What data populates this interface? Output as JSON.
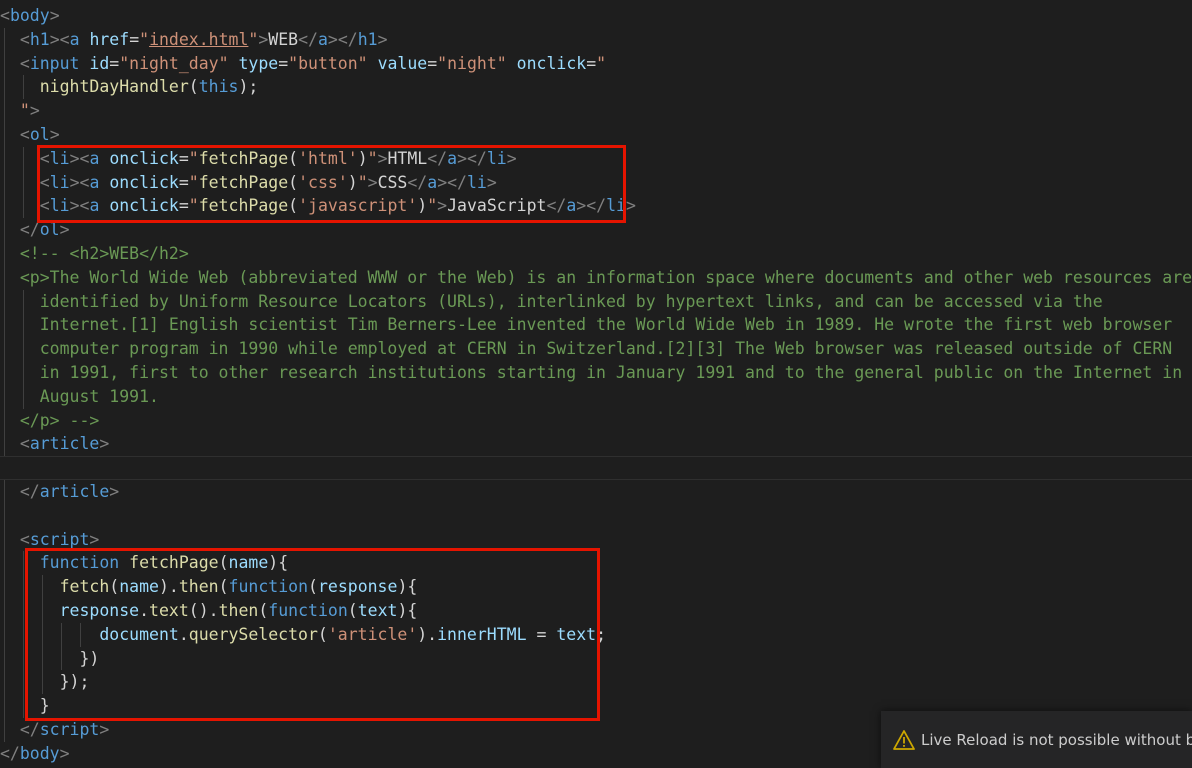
{
  "colors": {
    "background": "#1e1e1e",
    "punct": "#808080",
    "tag": "#569cd6",
    "attr": "#9cdcfe",
    "string": "#ce9178",
    "text": "#d4d4d4",
    "function": "#dcdcaa",
    "keyword": "#569cd6",
    "variable": "#9cdcfe",
    "comment": "#6a9955",
    "highlight_border": "#e51400",
    "warning_icon": "#cca700"
  },
  "editor": {
    "lines": [
      {
        "guides": [],
        "tokens": [
          {
            "t": "<",
            "c": "punct"
          },
          {
            "t": "body",
            "c": "tag"
          },
          {
            "t": ">",
            "c": "punct"
          }
        ]
      },
      {
        "guides": [
          0
        ],
        "tokens": [
          {
            "t": "  "
          },
          {
            "t": "<",
            "c": "punct"
          },
          {
            "t": "h1",
            "c": "tag"
          },
          {
            "t": ">",
            "c": "punct"
          },
          {
            "t": "<",
            "c": "punct"
          },
          {
            "t": "a",
            "c": "tag"
          },
          {
            "t": " "
          },
          {
            "t": "href",
            "c": "attr"
          },
          {
            "t": "=",
            "c": "txt"
          },
          {
            "t": "\"",
            "c": "str"
          },
          {
            "t": "index.html",
            "c": "str",
            "u": true
          },
          {
            "t": "\"",
            "c": "str"
          },
          {
            "t": ">",
            "c": "punct"
          },
          {
            "t": "WEB",
            "c": "txt"
          },
          {
            "t": "</",
            "c": "punct"
          },
          {
            "t": "a",
            "c": "tag"
          },
          {
            "t": ">",
            "c": "punct"
          },
          {
            "t": "</",
            "c": "punct"
          },
          {
            "t": "h1",
            "c": "tag"
          },
          {
            "t": ">",
            "c": "punct"
          }
        ]
      },
      {
        "guides": [
          0
        ],
        "tokens": [
          {
            "t": "  "
          },
          {
            "t": "<",
            "c": "punct"
          },
          {
            "t": "input",
            "c": "tag"
          },
          {
            "t": " "
          },
          {
            "t": "id",
            "c": "attr"
          },
          {
            "t": "=",
            "c": "txt"
          },
          {
            "t": "\"night_day\"",
            "c": "str"
          },
          {
            "t": " "
          },
          {
            "t": "type",
            "c": "attr"
          },
          {
            "t": "=",
            "c": "txt"
          },
          {
            "t": "\"button\"",
            "c": "str"
          },
          {
            "t": " "
          },
          {
            "t": "value",
            "c": "attr"
          },
          {
            "t": "=",
            "c": "txt"
          },
          {
            "t": "\"night\"",
            "c": "str"
          },
          {
            "t": " "
          },
          {
            "t": "onclick",
            "c": "attr"
          },
          {
            "t": "=",
            "c": "txt"
          },
          {
            "t": "\"",
            "c": "str"
          }
        ]
      },
      {
        "guides": [
          0,
          2
        ],
        "tokens": [
          {
            "t": "    "
          },
          {
            "t": "nightDayHandler",
            "c": "fn"
          },
          {
            "t": "(",
            "c": "txt"
          },
          {
            "t": "this",
            "c": "kw"
          },
          {
            "t": ");",
            "c": "txt"
          }
        ]
      },
      {
        "guides": [
          0
        ],
        "tokens": [
          {
            "t": "  "
          },
          {
            "t": "\"",
            "c": "str"
          },
          {
            "t": ">",
            "c": "punct"
          }
        ]
      },
      {
        "guides": [
          0
        ],
        "tokens": [
          {
            "t": "  "
          },
          {
            "t": "<",
            "c": "punct"
          },
          {
            "t": "ol",
            "c": "tag"
          },
          {
            "t": ">",
            "c": "punct"
          }
        ]
      },
      {
        "guides": [
          0,
          2
        ],
        "tokens": [
          {
            "t": "    "
          },
          {
            "t": "<",
            "c": "punct"
          },
          {
            "t": "li",
            "c": "tag"
          },
          {
            "t": ">",
            "c": "punct"
          },
          {
            "t": "<",
            "c": "punct"
          },
          {
            "t": "a",
            "c": "tag"
          },
          {
            "t": " "
          },
          {
            "t": "onclick",
            "c": "attr"
          },
          {
            "t": "=",
            "c": "txt"
          },
          {
            "t": "\"",
            "c": "str"
          },
          {
            "t": "fetchPage",
            "c": "fn"
          },
          {
            "t": "(",
            "c": "txt"
          },
          {
            "t": "'html'",
            "c": "str"
          },
          {
            "t": ")",
            "c": "txt"
          },
          {
            "t": "\"",
            "c": "str"
          },
          {
            "t": ">",
            "c": "punct"
          },
          {
            "t": "HTML",
            "c": "txt"
          },
          {
            "t": "</",
            "c": "punct"
          },
          {
            "t": "a",
            "c": "tag"
          },
          {
            "t": ">",
            "c": "punct"
          },
          {
            "t": "</",
            "c": "punct"
          },
          {
            "t": "li",
            "c": "tag"
          },
          {
            "t": ">",
            "c": "punct"
          }
        ]
      },
      {
        "guides": [
          0,
          2
        ],
        "tokens": [
          {
            "t": "    "
          },
          {
            "t": "<",
            "c": "punct"
          },
          {
            "t": "li",
            "c": "tag"
          },
          {
            "t": ">",
            "c": "punct"
          },
          {
            "t": "<",
            "c": "punct"
          },
          {
            "t": "a",
            "c": "tag"
          },
          {
            "t": " "
          },
          {
            "t": "onclick",
            "c": "attr"
          },
          {
            "t": "=",
            "c": "txt"
          },
          {
            "t": "\"",
            "c": "str"
          },
          {
            "t": "fetchPage",
            "c": "fn"
          },
          {
            "t": "(",
            "c": "txt"
          },
          {
            "t": "'css'",
            "c": "str"
          },
          {
            "t": ")",
            "c": "txt"
          },
          {
            "t": "\"",
            "c": "str"
          },
          {
            "t": ">",
            "c": "punct"
          },
          {
            "t": "CSS",
            "c": "txt"
          },
          {
            "t": "</",
            "c": "punct"
          },
          {
            "t": "a",
            "c": "tag"
          },
          {
            "t": ">",
            "c": "punct"
          },
          {
            "t": "</",
            "c": "punct"
          },
          {
            "t": "li",
            "c": "tag"
          },
          {
            "t": ">",
            "c": "punct"
          }
        ]
      },
      {
        "guides": [
          0,
          2
        ],
        "tokens": [
          {
            "t": "    "
          },
          {
            "t": "<",
            "c": "punct"
          },
          {
            "t": "li",
            "c": "tag"
          },
          {
            "t": ">",
            "c": "punct"
          },
          {
            "t": "<",
            "c": "punct"
          },
          {
            "t": "a",
            "c": "tag"
          },
          {
            "t": " "
          },
          {
            "t": "onclick",
            "c": "attr"
          },
          {
            "t": "=",
            "c": "txt"
          },
          {
            "t": "\"",
            "c": "str"
          },
          {
            "t": "fetchPage",
            "c": "fn"
          },
          {
            "t": "(",
            "c": "txt"
          },
          {
            "t": "'javascript'",
            "c": "str"
          },
          {
            "t": ")",
            "c": "txt"
          },
          {
            "t": "\"",
            "c": "str"
          },
          {
            "t": ">",
            "c": "punct"
          },
          {
            "t": "JavaScript",
            "c": "txt"
          },
          {
            "t": "</",
            "c": "punct"
          },
          {
            "t": "a",
            "c": "tag"
          },
          {
            "t": ">",
            "c": "punct"
          },
          {
            "t": "</",
            "c": "punct"
          },
          {
            "t": "li",
            "c": "tag"
          },
          {
            "t": ">",
            "c": "punct"
          }
        ]
      },
      {
        "guides": [
          0
        ],
        "tokens": [
          {
            "t": "  "
          },
          {
            "t": "</",
            "c": "punct"
          },
          {
            "t": "ol",
            "c": "tag"
          },
          {
            "t": ">",
            "c": "punct"
          }
        ]
      },
      {
        "guides": [
          0
        ],
        "tokens": [
          {
            "t": "  "
          },
          {
            "t": "<!-- <h2>WEB</h2>",
            "c": "cmt"
          }
        ]
      },
      {
        "guides": [
          0
        ],
        "tokens": [
          {
            "t": "  "
          },
          {
            "t": "<p>The World Wide Web (abbreviated WWW or the Web) is an information space where documents and other web resources are",
            "c": "cmt"
          }
        ]
      },
      {
        "guides": [
          0,
          2
        ],
        "tokens": [
          {
            "t": "    "
          },
          {
            "t": "identified by Uniform Resource Locators (URLs), interlinked by hypertext links, and can be accessed via the",
            "c": "cmt"
          }
        ]
      },
      {
        "guides": [
          0,
          2
        ],
        "tokens": [
          {
            "t": "    "
          },
          {
            "t": "Internet.[1] English scientist Tim Berners-Lee invented the World Wide Web in 1989. He wrote the first web browser",
            "c": "cmt"
          }
        ]
      },
      {
        "guides": [
          0,
          2
        ],
        "tokens": [
          {
            "t": "    "
          },
          {
            "t": "computer program in 1990 while employed at CERN in Switzerland.[2][3] The Web browser was released outside of CERN",
            "c": "cmt"
          }
        ]
      },
      {
        "guides": [
          0,
          2
        ],
        "tokens": [
          {
            "t": "    "
          },
          {
            "t": "in 1991, first to other research institutions starting in January 1991 and to the general public on the Internet in",
            "c": "cmt"
          }
        ]
      },
      {
        "guides": [
          0,
          2
        ],
        "tokens": [
          {
            "t": "    "
          },
          {
            "t": "August 1991.",
            "c": "cmt"
          }
        ]
      },
      {
        "guides": [
          0
        ],
        "tokens": [
          {
            "t": "  "
          },
          {
            "t": "</p> -->",
            "c": "cmt"
          }
        ]
      },
      {
        "guides": [
          0
        ],
        "tokens": [
          {
            "t": "  "
          },
          {
            "t": "<",
            "c": "punct"
          },
          {
            "t": "article",
            "c": "tag"
          },
          {
            "t": ">",
            "c": "punct"
          }
        ]
      },
      {
        "guides": [],
        "current": true,
        "tokens": []
      },
      {
        "guides": [
          0
        ],
        "tokens": [
          {
            "t": "  "
          },
          {
            "t": "</",
            "c": "punct"
          },
          {
            "t": "article",
            "c": "tag"
          },
          {
            "t": ">",
            "c": "punct"
          }
        ]
      },
      {
        "guides": [
          0
        ],
        "tokens": []
      },
      {
        "guides": [
          0
        ],
        "tokens": [
          {
            "t": "  "
          },
          {
            "t": "<",
            "c": "punct"
          },
          {
            "t": "script",
            "c": "tag"
          },
          {
            "t": ">",
            "c": "punct"
          }
        ]
      },
      {
        "guides": [
          0,
          2
        ],
        "tokens": [
          {
            "t": "    "
          },
          {
            "t": "function",
            "c": "kw"
          },
          {
            "t": " "
          },
          {
            "t": "fetchPage",
            "c": "fn"
          },
          {
            "t": "(",
            "c": "txt"
          },
          {
            "t": "name",
            "c": "var"
          },
          {
            "t": "){",
            "c": "txt"
          }
        ]
      },
      {
        "guides": [
          0,
          2,
          4
        ],
        "tokens": [
          {
            "t": "      "
          },
          {
            "t": "fetch",
            "c": "fn"
          },
          {
            "t": "(",
            "c": "txt"
          },
          {
            "t": "name",
            "c": "var"
          },
          {
            "t": ").",
            "c": "txt"
          },
          {
            "t": "then",
            "c": "fn"
          },
          {
            "t": "(",
            "c": "txt"
          },
          {
            "t": "function",
            "c": "kw"
          },
          {
            "t": "(",
            "c": "txt"
          },
          {
            "t": "response",
            "c": "var"
          },
          {
            "t": "){",
            "c": "txt"
          }
        ]
      },
      {
        "guides": [
          0,
          2,
          4
        ],
        "tokens": [
          {
            "t": "      "
          },
          {
            "t": "response",
            "c": "var"
          },
          {
            "t": ".",
            "c": "txt"
          },
          {
            "t": "text",
            "c": "fn"
          },
          {
            "t": "().",
            "c": "txt"
          },
          {
            "t": "then",
            "c": "fn"
          },
          {
            "t": "(",
            "c": "txt"
          },
          {
            "t": "function",
            "c": "kw"
          },
          {
            "t": "(",
            "c": "txt"
          },
          {
            "t": "text",
            "c": "var"
          },
          {
            "t": "){",
            "c": "txt"
          }
        ]
      },
      {
        "guides": [
          0,
          2,
          4,
          6,
          8
        ],
        "tokens": [
          {
            "t": "          "
          },
          {
            "t": "document",
            "c": "var"
          },
          {
            "t": ".",
            "c": "txt"
          },
          {
            "t": "querySelector",
            "c": "fn"
          },
          {
            "t": "(",
            "c": "txt"
          },
          {
            "t": "'article'",
            "c": "str"
          },
          {
            "t": ").",
            "c": "txt"
          },
          {
            "t": "innerHTML",
            "c": "var"
          },
          {
            "t": " = ",
            "c": "txt"
          },
          {
            "t": "text",
            "c": "var"
          },
          {
            "t": ";",
            "c": "txt"
          }
        ]
      },
      {
        "guides": [
          0,
          2,
          4,
          6
        ],
        "tokens": [
          {
            "t": "        "
          },
          {
            "t": "})",
            "c": "txt"
          }
        ]
      },
      {
        "guides": [
          0,
          2,
          4
        ],
        "tokens": [
          {
            "t": "      "
          },
          {
            "t": "});",
            "c": "txt"
          }
        ]
      },
      {
        "guides": [
          0,
          2
        ],
        "tokens": [
          {
            "t": "    "
          },
          {
            "t": "}",
            "c": "txt"
          }
        ]
      },
      {
        "guides": [
          0
        ],
        "tokens": [
          {
            "t": "  "
          },
          {
            "t": "</",
            "c": "punct"
          },
          {
            "t": "script",
            "c": "tag"
          },
          {
            "t": ">",
            "c": "punct"
          }
        ]
      },
      {
        "guides": [],
        "tokens": [
          {
            "t": "</",
            "c": "punct"
          },
          {
            "t": "body",
            "c": "tag"
          },
          {
            "t": ">",
            "c": "punct"
          }
        ]
      }
    ]
  },
  "notification": {
    "icon": "warning-icon",
    "text": "Live Reload is not possible without body or head tag."
  }
}
